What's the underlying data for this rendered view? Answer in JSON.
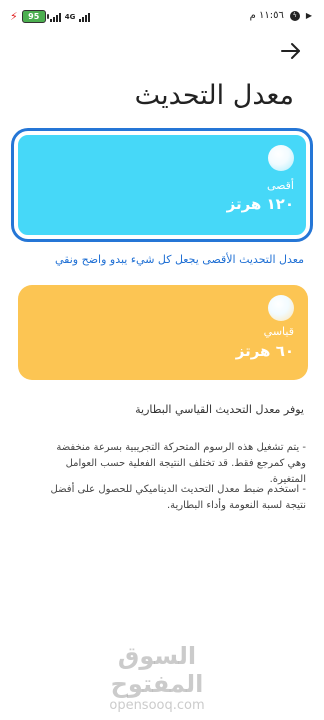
{
  "status_bar": {
    "time": "١١:٥٦ م",
    "battery_level": "95",
    "network": "4G"
  },
  "header": {
    "title": "معدل التحديث",
    "back_icon": "arrow-right-icon"
  },
  "options": [
    {
      "id": "max",
      "mode_label": "أقصى",
      "rate_label": "١٢٠ هرتز",
      "color": "#46d8f8",
      "selected": true,
      "caption": "معدل التحديث الأقصى يجعل كل شيء يبدو واضح ونقي"
    },
    {
      "id": "standard",
      "mode_label": "قياسي",
      "rate_label": "٦٠ هرتز",
      "color": "#fcc553",
      "selected": false,
      "caption": "يوفر معدل التحديث القياسي البطارية"
    }
  ],
  "notes": [
    "- يتم تشغيل هذه الرسوم المتحركة التجريبية بسرعة منخفضة وهي كمرجع فقط. قد تختلف النتيجة الفعلية حسب العوامل المتغيرة.",
    "- استخدم ضبط معدل التحديث الديناميكي للحصول على أفضل نتيجة لسبة النعومة وأداء البطارية."
  ],
  "watermark": {
    "arabic": "السوق المفتوح",
    "latin": "opensooq.com"
  },
  "accent_color": "#2576d6"
}
